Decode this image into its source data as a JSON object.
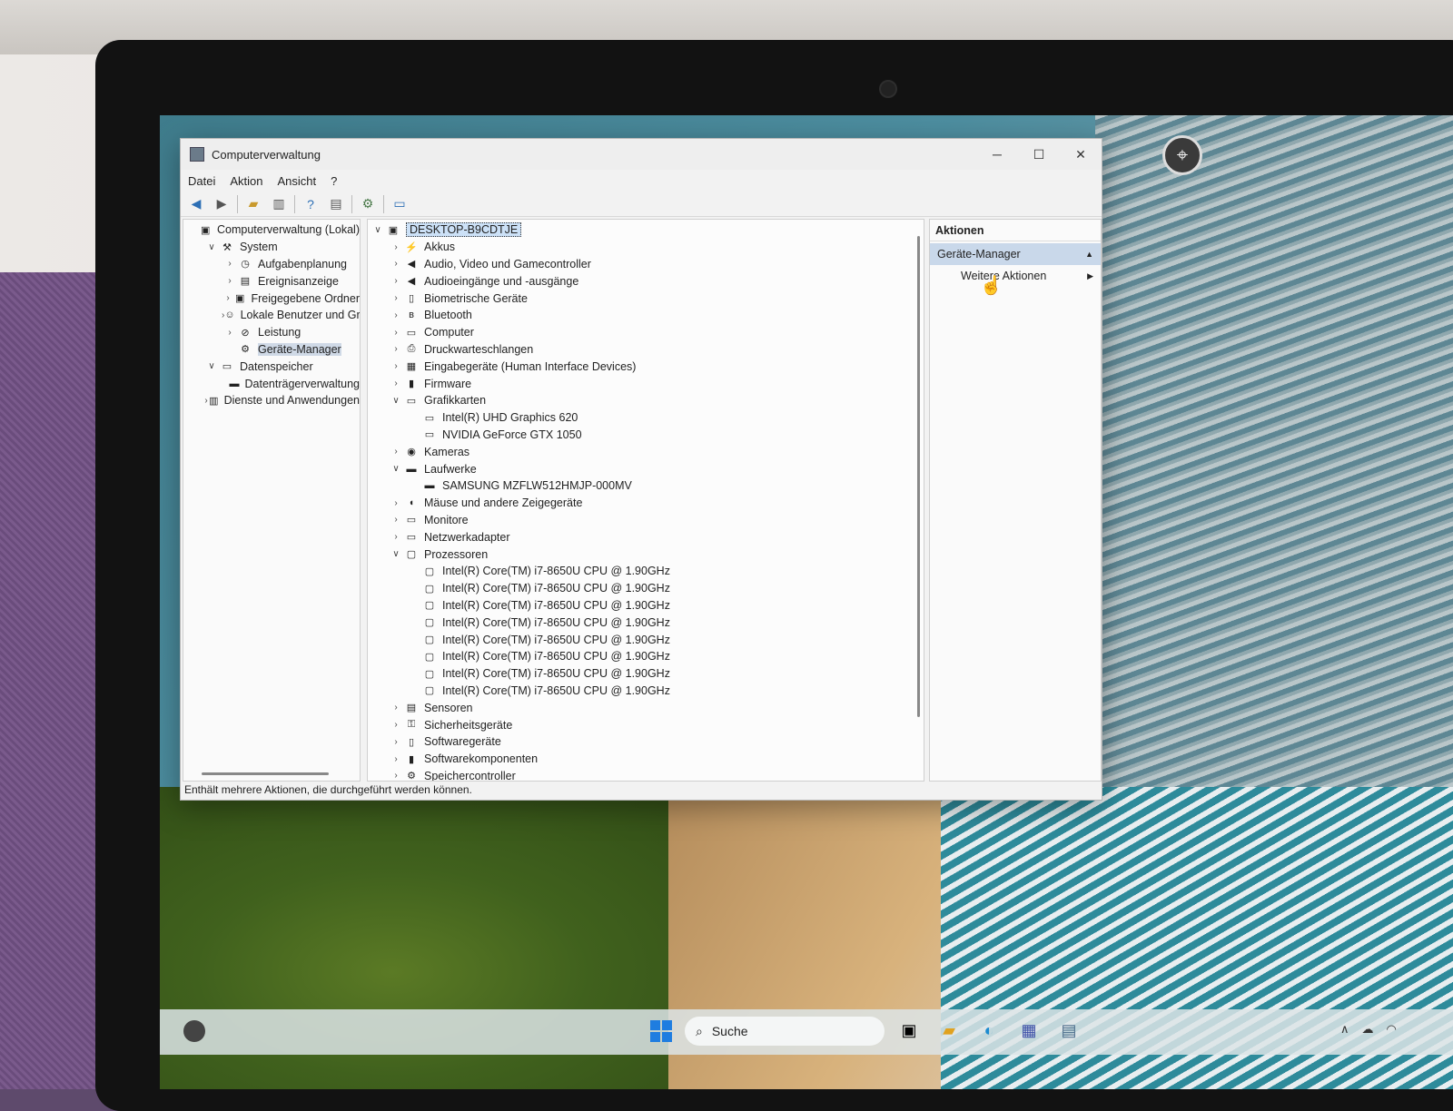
{
  "window": {
    "title": "Computerverwaltung",
    "minimize": "─",
    "maximize": "☐",
    "close": "✕"
  },
  "menu": {
    "file": "Datei",
    "action": "Aktion",
    "view": "Ansicht",
    "help": "?"
  },
  "left_tree": [
    {
      "label": "Computerverwaltung (Lokal)",
      "level": 0,
      "chev": "",
      "icon": "computer-management-icon",
      "glyph": "▣"
    },
    {
      "label": "System",
      "level": 1,
      "chev": "∨",
      "icon": "tools-icon",
      "glyph": "⚒"
    },
    {
      "label": "Aufgabenplanung",
      "level": 2,
      "chev": "›",
      "icon": "clock-icon",
      "glyph": "◷"
    },
    {
      "label": "Ereignisanzeige",
      "level": 2,
      "chev": "›",
      "icon": "event-viewer-icon",
      "glyph": "▤"
    },
    {
      "label": "Freigegebene Ordner",
      "level": 2,
      "chev": "›",
      "icon": "shared-folder-icon",
      "glyph": "▣"
    },
    {
      "label": "Lokale Benutzer und Gru",
      "level": 2,
      "chev": "›",
      "icon": "users-icon",
      "glyph": "☺"
    },
    {
      "label": "Leistung",
      "level": 2,
      "chev": "›",
      "icon": "performance-icon",
      "glyph": "⊘"
    },
    {
      "label": "Geräte-Manager",
      "level": 2,
      "chev": "",
      "icon": "device-manager-icon",
      "glyph": "⚙",
      "selected": true
    },
    {
      "label": "Datenspeicher",
      "level": 1,
      "chev": "∨",
      "icon": "storage-icon",
      "glyph": "▭"
    },
    {
      "label": "Datenträgerverwaltung",
      "level": 2,
      "chev": "",
      "icon": "disk-management-icon",
      "glyph": "▬"
    },
    {
      "label": "Dienste und Anwendungen",
      "level": 1,
      "chev": "›",
      "icon": "services-icon",
      "glyph": "▥"
    }
  ],
  "device_tree": [
    {
      "label": "DESKTOP-B9CDTJE",
      "level": 0,
      "chev": "∨",
      "icon": "computer-root-icon",
      "glyph": "▣",
      "root": true
    },
    {
      "label": "Akkus",
      "level": 1,
      "chev": "›",
      "icon": "battery-icon",
      "glyph": "⚡"
    },
    {
      "label": "Audio, Video und Gamecontroller",
      "level": 1,
      "chev": "›",
      "icon": "speaker-icon",
      "glyph": "◀"
    },
    {
      "label": "Audioeingänge und -ausgänge",
      "level": 1,
      "chev": "›",
      "icon": "speaker-icon",
      "glyph": "◀"
    },
    {
      "label": "Biometrische Geräte",
      "level": 1,
      "chev": "›",
      "icon": "biometric-icon",
      "glyph": "▯"
    },
    {
      "label": "Bluetooth",
      "level": 1,
      "chev": "›",
      "icon": "bluetooth-icon",
      "glyph": "ʙ"
    },
    {
      "label": "Computer",
      "level": 1,
      "chev": "›",
      "icon": "monitor-icon",
      "glyph": "▭"
    },
    {
      "label": "Druckwarteschlangen",
      "level": 1,
      "chev": "›",
      "icon": "printer-icon",
      "glyph": "⎙"
    },
    {
      "label": "Eingabegeräte (Human Interface Devices)",
      "level": 1,
      "chev": "›",
      "icon": "hid-icon",
      "glyph": "▦"
    },
    {
      "label": "Firmware",
      "level": 1,
      "chev": "›",
      "icon": "firmware-icon",
      "glyph": "▮"
    },
    {
      "label": "Grafikkarten",
      "level": 1,
      "chev": "∨",
      "icon": "display-adapter-icon",
      "glyph": "▭"
    },
    {
      "label": "Intel(R) UHD Graphics 620",
      "level": 2,
      "chev": "",
      "icon": "display-adapter-icon",
      "glyph": "▭"
    },
    {
      "label": "NVIDIA GeForce GTX 1050",
      "level": 2,
      "chev": "",
      "icon": "display-adapter-icon",
      "glyph": "▭"
    },
    {
      "label": "Kameras",
      "level": 1,
      "chev": "›",
      "icon": "camera-icon",
      "glyph": "◉"
    },
    {
      "label": "Laufwerke",
      "level": 1,
      "chev": "∨",
      "icon": "drive-icon",
      "glyph": "▬"
    },
    {
      "label": "SAMSUNG MZFLW512HMJP-000MV",
      "level": 2,
      "chev": "",
      "icon": "drive-icon",
      "glyph": "▬"
    },
    {
      "label": "Mäuse und andere Zeigegeräte",
      "level": 1,
      "chev": "›",
      "icon": "mouse-icon",
      "glyph": "◖"
    },
    {
      "label": "Monitore",
      "level": 1,
      "chev": "›",
      "icon": "monitor-icon",
      "glyph": "▭"
    },
    {
      "label": "Netzwerkadapter",
      "level": 1,
      "chev": "›",
      "icon": "network-adapter-icon",
      "glyph": "▭"
    },
    {
      "label": "Prozessoren",
      "level": 1,
      "chev": "∨",
      "icon": "processor-icon",
      "glyph": "▢"
    },
    {
      "label": "Intel(R) Core(TM) i7-8650U CPU @ 1.90GHz",
      "level": 2,
      "chev": "",
      "icon": "processor-icon",
      "glyph": "▢"
    },
    {
      "label": "Intel(R) Core(TM) i7-8650U CPU @ 1.90GHz",
      "level": 2,
      "chev": "",
      "icon": "processor-icon",
      "glyph": "▢"
    },
    {
      "label": "Intel(R) Core(TM) i7-8650U CPU @ 1.90GHz",
      "level": 2,
      "chev": "",
      "icon": "processor-icon",
      "glyph": "▢"
    },
    {
      "label": "Intel(R) Core(TM) i7-8650U CPU @ 1.90GHz",
      "level": 2,
      "chev": "",
      "icon": "processor-icon",
      "glyph": "▢"
    },
    {
      "label": "Intel(R) Core(TM) i7-8650U CPU @ 1.90GHz",
      "level": 2,
      "chev": "",
      "icon": "processor-icon",
      "glyph": "▢"
    },
    {
      "label": "Intel(R) Core(TM) i7-8650U CPU @ 1.90GHz",
      "level": 2,
      "chev": "",
      "icon": "processor-icon",
      "glyph": "▢"
    },
    {
      "label": "Intel(R) Core(TM) i7-8650U CPU @ 1.90GHz",
      "level": 2,
      "chev": "",
      "icon": "processor-icon",
      "glyph": "▢"
    },
    {
      "label": "Intel(R) Core(TM) i7-8650U CPU @ 1.90GHz",
      "level": 2,
      "chev": "",
      "icon": "processor-icon",
      "glyph": "▢"
    },
    {
      "label": "Sensoren",
      "level": 1,
      "chev": "›",
      "icon": "sensor-icon",
      "glyph": "▤"
    },
    {
      "label": "Sicherheitsgeräte",
      "level": 1,
      "chev": "›",
      "icon": "security-device-icon",
      "glyph": "⚿"
    },
    {
      "label": "Softwaregeräte",
      "level": 1,
      "chev": "›",
      "icon": "software-device-icon",
      "glyph": "▯"
    },
    {
      "label": "Softwarekomponenten",
      "level": 1,
      "chev": "›",
      "icon": "software-component-icon",
      "glyph": "▮"
    },
    {
      "label": "Speichercontroller",
      "level": 1,
      "chev": "›",
      "icon": "storage-controller-icon",
      "glyph": "⚙"
    }
  ],
  "actions": {
    "header": "Aktionen",
    "group": "Geräte-Manager",
    "group_arrow": "▲",
    "item": "Weitere Aktionen",
    "item_arrow": "▶"
  },
  "status": "Enthält mehrere Aktionen, die durchgeführt werden können.",
  "taskbar": {
    "search_placeholder": "Suche"
  },
  "colors": {
    "accent": "#1f7de0",
    "selection": "#cfd9e6"
  }
}
